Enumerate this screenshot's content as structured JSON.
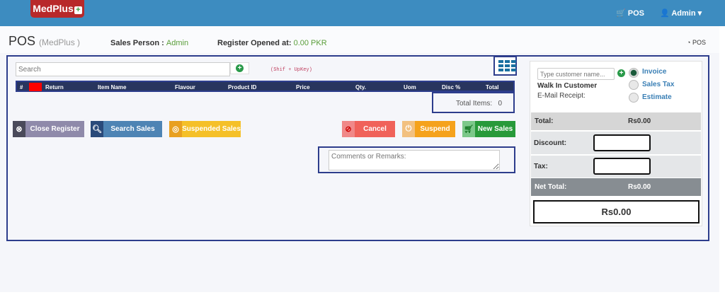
{
  "nav": {
    "logo": "MedPlus",
    "pos": "POS",
    "user": "Admin"
  },
  "header": {
    "title": "POS",
    "store": "(MedPlus   )",
    "sales_person_label": "Sales Person :",
    "sales_person": "Admin",
    "register_label": "Register Opened at:",
    "register_value": "0.00 PKR",
    "pos_link": "POS"
  },
  "search": {
    "placeholder": "Search",
    "hint": "(Shif + UpKey)"
  },
  "table": {
    "columns": [
      "#",
      "",
      "Return",
      "Item Name",
      "Flavour",
      "Product ID",
      "Price",
      "Qty.",
      "Uom",
      "Disc %",
      "Total"
    ]
  },
  "total_items": {
    "label": "Total Items:",
    "value": "0"
  },
  "buttons": {
    "close_register": "Close Register",
    "search_sales": "Search Sales",
    "suspended_sales": "Suspended Sales",
    "cancel": "Cancel",
    "suspend": "Suspend",
    "new_sales": "New Sales"
  },
  "comments": {
    "placeholder": "Comments or Remarks:"
  },
  "customer": {
    "placeholder": "Type customer name...",
    "name": "Walk In Customer",
    "email_label": "E-Mail Receipt:"
  },
  "invoice_types": [
    {
      "label": "Invoice",
      "selected": true
    },
    {
      "label": "Sales Tax",
      "selected": false
    },
    {
      "label": "Estimate",
      "selected": false
    }
  ],
  "summary": {
    "total_label": "Total:",
    "total": "Rs0.00",
    "discount_label": "Discount:",
    "tax_label": "Tax:",
    "net_label": "Net Total:",
    "net": "Rs0.00",
    "grand": "Rs0.00"
  },
  "colors": {
    "nav": "#3d8cc0",
    "frame": "#2d3d8c",
    "table_header": "#28355e",
    "accent_green": "#5a9e3a"
  }
}
